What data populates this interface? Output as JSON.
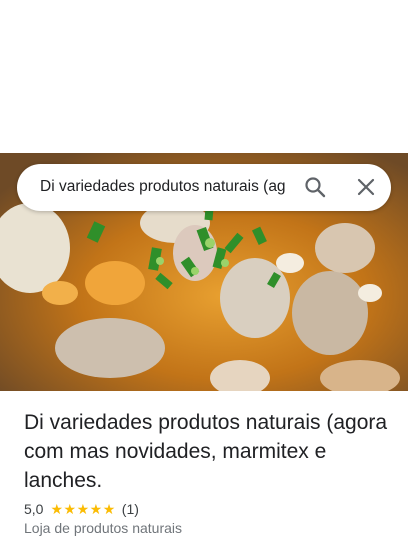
{
  "search": {
    "query": "Di variedades produtos naturais (ag",
    "search_icon": "search-icon",
    "close_icon": "close-icon"
  },
  "place": {
    "title": "Di variedades produtos naturais (agora com mas novidades, marmitex e lanches.",
    "rating": "5,0",
    "stars": 5,
    "review_count": "(1)",
    "category": "Loja de produtos naturais"
  },
  "colors": {
    "star": "#fbbc04",
    "title_text": "#202124",
    "secondary_text": "#70757a"
  }
}
